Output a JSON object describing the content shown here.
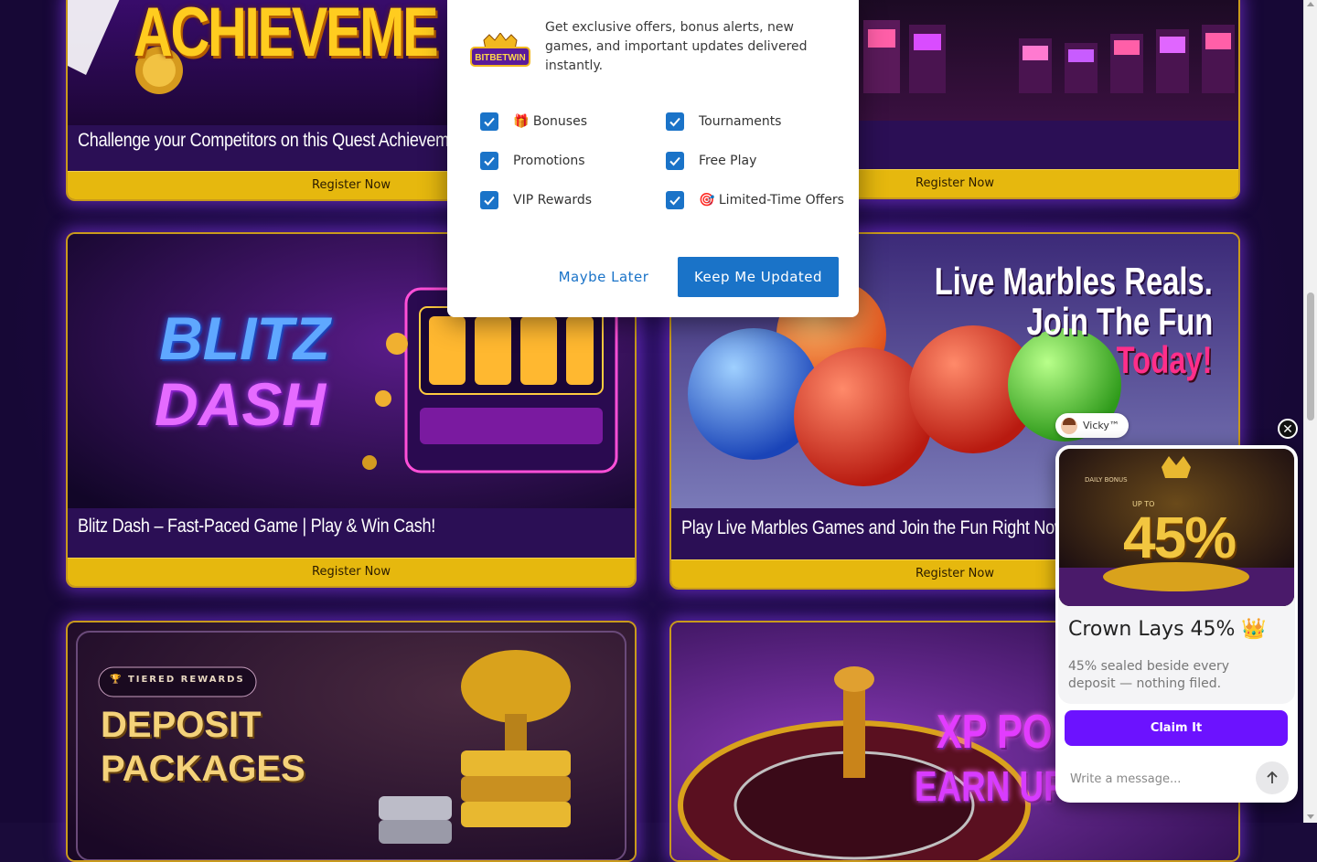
{
  "cards": [
    {
      "caption": "Challenge your Competitors on this Quest Achievem",
      "button": "Register Now",
      "banner_text": "ACHIEVEME"
    },
    {
      "caption": "",
      "button": "Register Now"
    },
    {
      "caption": "Blitz Dash – Fast-Paced Game | Play & Win Cash!",
      "button": "Register Now",
      "banner_line1": "BLITZ",
      "banner_line2": "DASH"
    },
    {
      "caption": "Play Live Marbles Games and Join the Fun Right Now",
      "button": "Register Now",
      "banner_line1": "Live Marbles Reals.",
      "banner_line2": "Join The Fun",
      "banner_line3": "Today!"
    },
    {
      "badge": "TIERED REWARDS",
      "banner_line1": "DEPOSIT",
      "banner_line2": "PACKAGES"
    },
    {
      "banner_line1": "XP PO",
      "banner_line2": "EARN UP"
    }
  ],
  "modal": {
    "logo_text": "BITBETWIN",
    "message": "Get exclusive offers, bonus alerts, new games, and important updates delivered instantly.",
    "options": [
      {
        "label": "🎁 Bonuses",
        "checked": true
      },
      {
        "label": "Tournaments",
        "checked": true
      },
      {
        "label": "Promotions",
        "checked": true
      },
      {
        "label": "Free Play",
        "checked": true
      },
      {
        "label": "VIP Rewards",
        "checked": true
      },
      {
        "label": "🎯 Limited-Time Offers",
        "checked": true
      }
    ],
    "later_label": "Maybe Later",
    "keep_label": "Keep Me Updated"
  },
  "chat": {
    "agent_name": "Vicky™",
    "close_symbol": "✕",
    "promo": {
      "small_label": "DAILY BONUS",
      "up_to": "UP TO",
      "percent": "45%",
      "title": "Crown Lays 45% 👑",
      "description": "45% sealed beside every deposit — nothing filed."
    },
    "claim_label": "Claim It",
    "input_placeholder": "Write a message..."
  },
  "colors": {
    "accent_blue": "#1a73c8",
    "claim_purple": "#6c12ff",
    "register_gold": "#e6b80e"
  }
}
